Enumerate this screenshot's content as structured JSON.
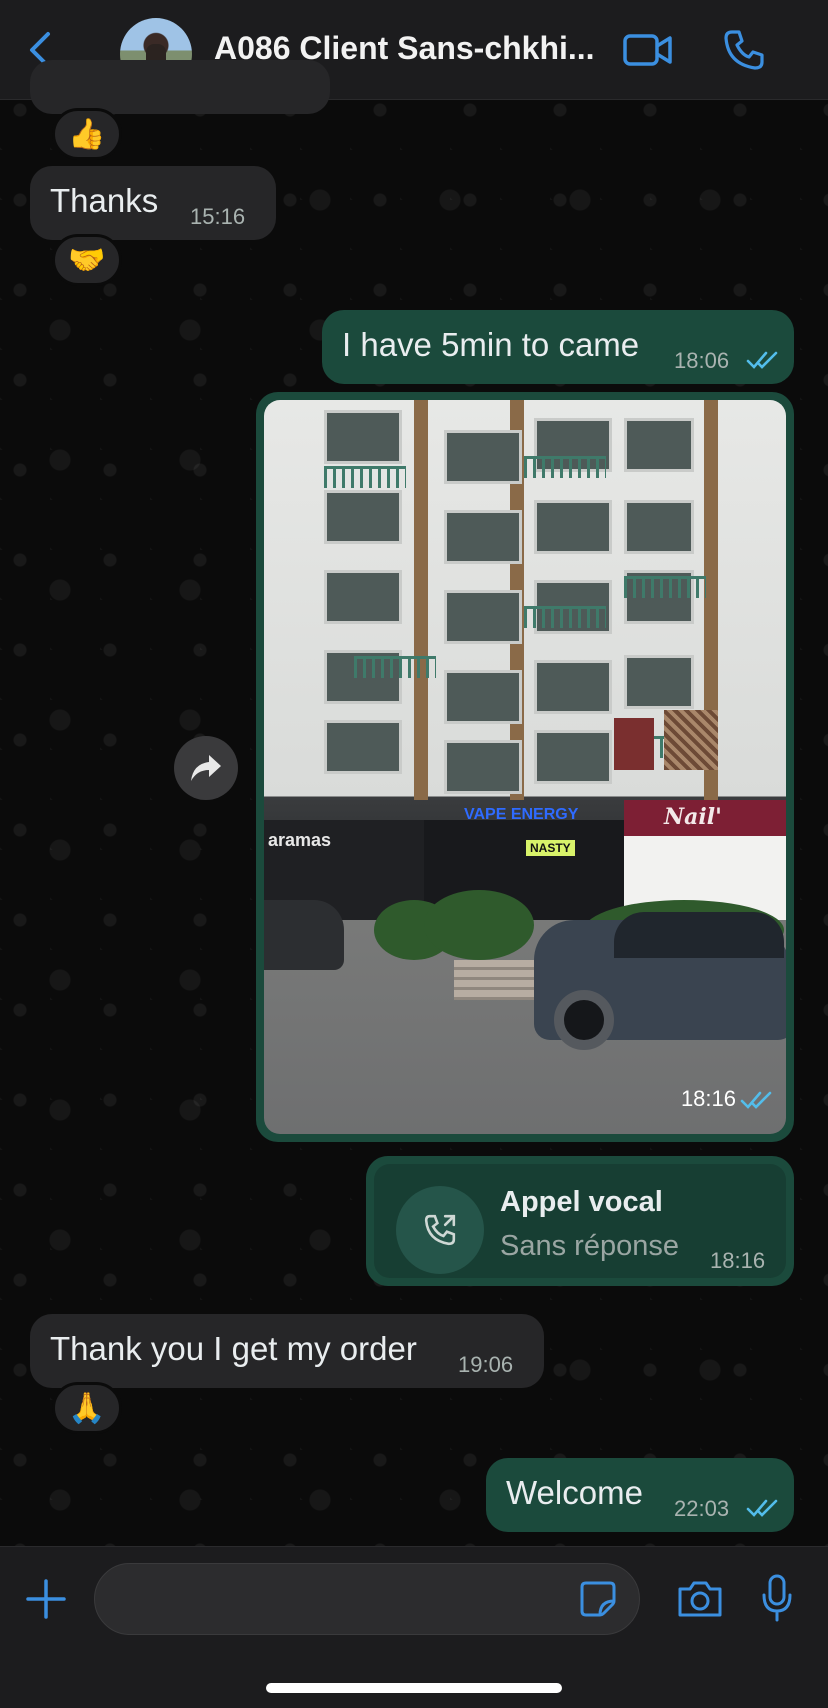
{
  "header": {
    "title": "A086 Client Sans-chkhi...",
    "accent": "#3b8fe0"
  },
  "messages": [
    {
      "type": "incoming",
      "text": "Thanks",
      "time": "15:16",
      "reaction": "🤝"
    },
    {
      "type": "outgoing",
      "text": "I have 5min to came",
      "time": "18:06",
      "status": "read"
    },
    {
      "type": "outgoing-image",
      "time": "18:16",
      "status": "read",
      "signs": [
        "aramas",
        "VAPE ENERGY",
        "NASTY",
        "Nail'"
      ]
    },
    {
      "type": "outgoing-call",
      "title": "Appel vocal",
      "subtitle": "Sans réponse",
      "time": "18:16"
    },
    {
      "type": "incoming",
      "text": "Thank you I get my order",
      "time": "19:06",
      "reaction": "🙏"
    },
    {
      "type": "outgoing",
      "text": "Welcome",
      "time": "22:03",
      "status": "read"
    }
  ],
  "earlier_reaction": "👍",
  "composer": {
    "placeholder": ""
  },
  "colors": {
    "incoming_bubble": "#262628",
    "outgoing_bubble": "#1b4a3c",
    "read_ticks": "#53bdeb"
  }
}
